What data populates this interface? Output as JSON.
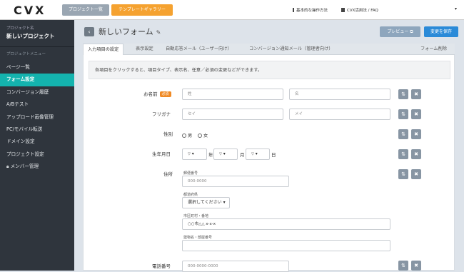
{
  "header": {
    "logo": "CVX",
    "project_list_label": "プロジェクト一覧",
    "template_gallery_label": "テンプレートギャラリー",
    "basic_ops_label": "基本的な操作方法",
    "faq_label": "CVX活用法 / FAQ"
  },
  "sidebar": {
    "project_caption": "プロジェクト名",
    "project_name": "新しいプロジェクト",
    "menu_heading": "プロジェクトメニュー",
    "items": [
      {
        "label": "ページ一覧"
      },
      {
        "label": "フォーム設定"
      },
      {
        "label": "コンバージョン履歴"
      },
      {
        "label": "A/Bテスト"
      },
      {
        "label": "アップロード画像管理"
      },
      {
        "label": "PC/モバイル転送"
      },
      {
        "label": "ドメイン設定"
      },
      {
        "label": "プロジェクト設定"
      },
      {
        "label": "メンバー管理"
      }
    ]
  },
  "main": {
    "title": "新しいフォーム",
    "preview_label": "プレビュー",
    "save_label": "変更を保存",
    "tabs": [
      {
        "label": "入力項目の設定"
      },
      {
        "label": "表示設定"
      },
      {
        "label": "自動応答メール（ユーザー向け）"
      },
      {
        "label": "コンバージョン通知メール（管理者向け）"
      },
      {
        "label": "フォーム削除"
      }
    ],
    "info_text": "各項目をクリックすると、項目タイプ、表示名、任意／必須の変更などができます。"
  },
  "form": {
    "required_badge": "必須",
    "name": {
      "label": "お名前",
      "last_placeholder": "姓",
      "first_placeholder": "名"
    },
    "furigana": {
      "label": "フリガナ",
      "last_placeholder": "セイ",
      "first_placeholder": "メイ"
    },
    "gender": {
      "label": "性別",
      "options": [
        "男",
        "女"
      ]
    },
    "birthday": {
      "label": "生年月日",
      "year_unit": "年",
      "month_unit": "月",
      "day_unit": "日"
    },
    "address": {
      "label": "住所",
      "zip_label": "郵便番号",
      "zip_placeholder": "000-0000",
      "pref_label": "都道府県",
      "pref_select": "選択してください",
      "city_label": "市区町村・番地",
      "city_placeholder": "○○市△△ x-x-x",
      "building_label": "建物名・部屋番号"
    },
    "phone": {
      "label": "電話番号",
      "placeholder": "000-0000-0000"
    }
  },
  "icons": {
    "sort": "⇅",
    "delete": "✖",
    "chevron": "▾"
  }
}
